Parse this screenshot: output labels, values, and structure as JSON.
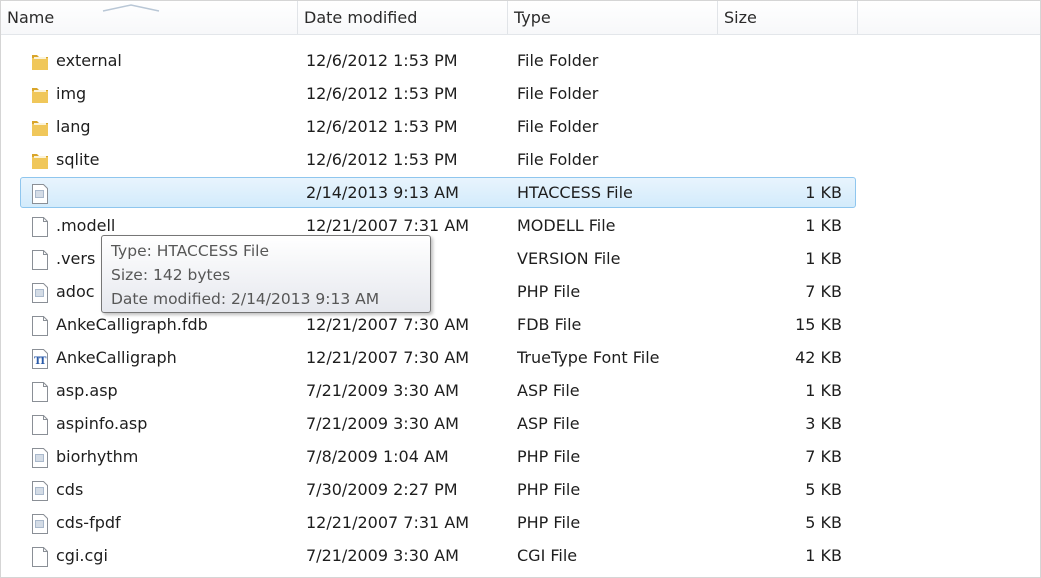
{
  "columns": {
    "name": "Name",
    "date": "Date modified",
    "type": "Type",
    "size": "Size"
  },
  "files": [
    {
      "name": "external",
      "date": "12/6/2012 1:53 PM",
      "type": "File Folder",
      "size": "",
      "icon": "folder-icon"
    },
    {
      "name": "img",
      "date": "12/6/2012 1:53 PM",
      "type": "File Folder",
      "size": "",
      "icon": "folder-icon"
    },
    {
      "name": "lang",
      "date": "12/6/2012 1:53 PM",
      "type": "File Folder",
      "size": "",
      "icon": "folder-icon"
    },
    {
      "name": "sqlite",
      "date": "12/6/2012 1:53 PM",
      "type": "File Folder",
      "size": "",
      "icon": "folder-icon"
    },
    {
      "name": "",
      "date": "2/14/2013 9:13 AM",
      "type": "HTACCESS File",
      "size": "1 KB",
      "icon": "text-file-icon",
      "selected": true
    },
    {
      "name": ".modell",
      "date": "12/21/2007 7:31 AM",
      "type": "MODELL File",
      "size": "1 KB",
      "icon": "blank-file-icon"
    },
    {
      "name": ".vers",
      "date": "PM",
      "type": "VERSION File",
      "size": "1 KB",
      "icon": "blank-file-icon"
    },
    {
      "name": "adoc",
      "date": "AM",
      "type": "PHP File",
      "size": "7 KB",
      "icon": "text-file-icon"
    },
    {
      "name": "AnkeCalligraph.fdb",
      "date": "12/21/2007 7:30 AM",
      "type": "FDB File",
      "size": "15 KB",
      "icon": "blank-file-icon"
    },
    {
      "name": "AnkeCalligraph",
      "date": "12/21/2007 7:30 AM",
      "type": "TrueType Font File",
      "size": "42 KB",
      "icon": "font-file-icon"
    },
    {
      "name": "asp.asp",
      "date": "7/21/2009 3:30 AM",
      "type": "ASP File",
      "size": "1 KB",
      "icon": "blank-file-icon"
    },
    {
      "name": "aspinfo.asp",
      "date": "7/21/2009 3:30 AM",
      "type": "ASP File",
      "size": "3 KB",
      "icon": "blank-file-icon"
    },
    {
      "name": "biorhythm",
      "date": "7/8/2009 1:04 AM",
      "type": "PHP File",
      "size": "7 KB",
      "icon": "text-file-icon"
    },
    {
      "name": "cds",
      "date": "7/30/2009 2:27 PM",
      "type": "PHP File",
      "size": "5 KB",
      "icon": "text-file-icon"
    },
    {
      "name": "cds-fpdf",
      "date": "12/21/2007 7:31 AM",
      "type": "PHP File",
      "size": "5 KB",
      "icon": "text-file-icon"
    },
    {
      "name": "cgi.cgi",
      "date": "7/21/2009 3:30 AM",
      "type": "CGI File",
      "size": "1 KB",
      "icon": "blank-file-icon"
    }
  ],
  "tooltip": {
    "type_line": "Type: HTACCESS File",
    "size_line": "Size: 142 bytes",
    "date_line": "Date modified: 2/14/2013 9:13 AM"
  },
  "colors": {
    "selection_border": "#8fc6ee",
    "selection_fill": "#d3ebfb",
    "folder": "#e8b53a"
  }
}
